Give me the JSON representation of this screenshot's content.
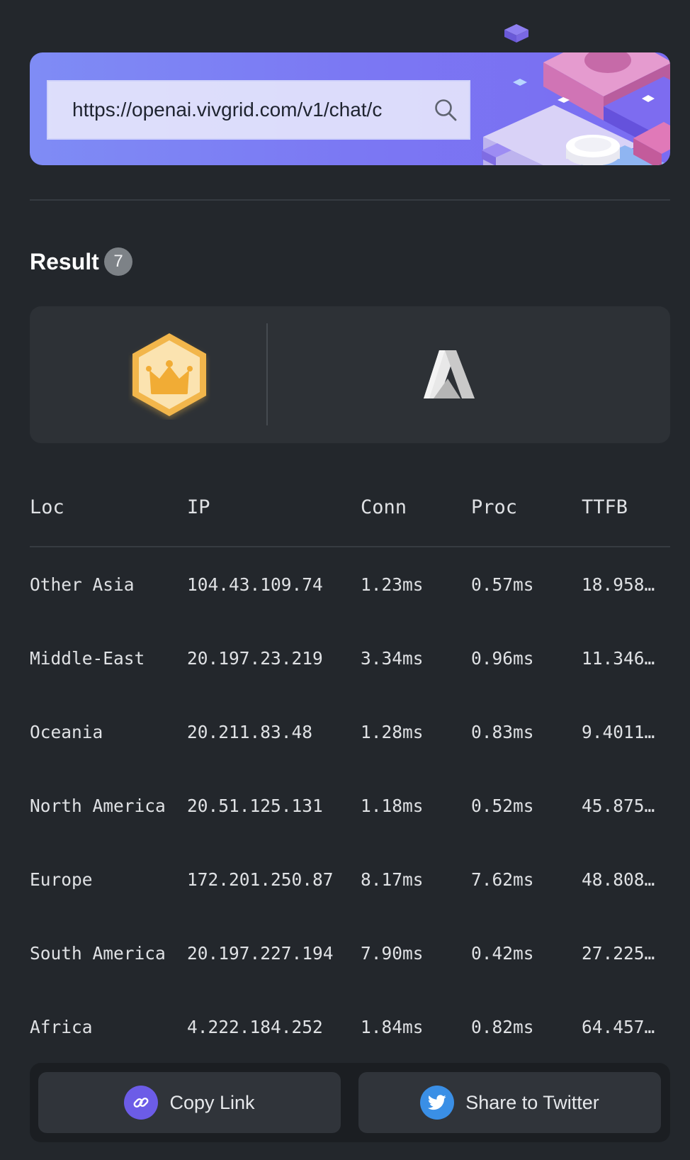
{
  "search": {
    "value": "https://openai.vivgrid.com/v1/chat/c"
  },
  "result": {
    "title": "Result",
    "count": "7"
  },
  "providers": {
    "badge_icon": "crown-badge-icon",
    "provider_logo": "azure-logo-icon"
  },
  "table": {
    "headers": {
      "loc": "Loc",
      "ip": "IP",
      "conn": "Conn",
      "proc": "Proc",
      "ttfb": "TTFB"
    },
    "rows": [
      {
        "loc": "Other Asia",
        "ip": "104.43.109.74",
        "conn": "1.23ms",
        "proc": "0.57ms",
        "ttfb": "18.958…"
      },
      {
        "loc": "Middle-East",
        "ip": "20.197.23.219",
        "conn": "3.34ms",
        "proc": "0.96ms",
        "ttfb": "11.346…"
      },
      {
        "loc": "Oceania",
        "ip": "20.211.83.48",
        "conn": "1.28ms",
        "proc": "0.83ms",
        "ttfb": "9.4011…"
      },
      {
        "loc": "North America",
        "ip": "20.51.125.131",
        "conn": "1.18ms",
        "proc": "0.52ms",
        "ttfb": "45.875…"
      },
      {
        "loc": "Europe",
        "ip": "172.201.250.87",
        "conn": "8.17ms",
        "proc": "7.62ms",
        "ttfb": "48.808…"
      },
      {
        "loc": "South America",
        "ip": "20.197.227.194",
        "conn": "7.90ms",
        "proc": "0.42ms",
        "ttfb": "27.225…"
      },
      {
        "loc": "Africa",
        "ip": "4.222.184.252",
        "conn": "1.84ms",
        "proc": "0.82ms",
        "ttfb": "64.457…"
      }
    ]
  },
  "actions": {
    "copy_label": "Copy Link",
    "twitter_label": "Share to Twitter"
  },
  "colors": {
    "background": "#23272c",
    "banner_accent": "#7b78f3",
    "copy_icon_bg": "#6c5ce7",
    "twitter_icon_bg": "#3a8fe6"
  }
}
